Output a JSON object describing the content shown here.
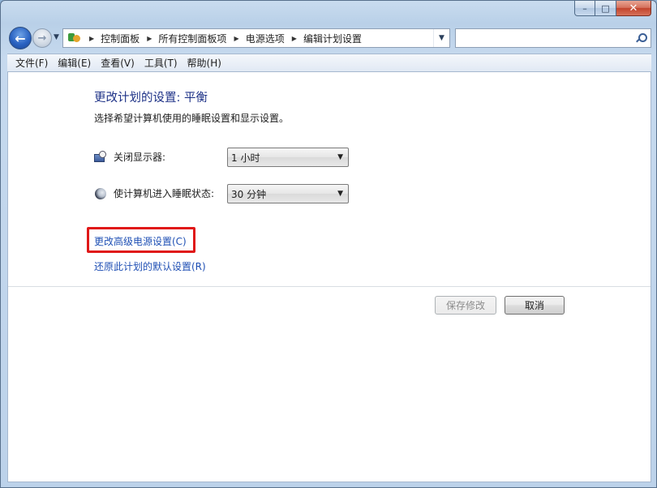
{
  "window": {
    "controls": {
      "minimize": "▭",
      "maximize": "□",
      "close": "✕"
    }
  },
  "address": {
    "breadcrumbs": [
      "控制面板",
      "所有控制面板项",
      "电源选项",
      "编辑计划设置"
    ],
    "icon": "control-panel-icon"
  },
  "search": {
    "placeholder": ""
  },
  "menu": {
    "items": [
      "文件(F)",
      "编辑(E)",
      "查看(V)",
      "工具(T)",
      "帮助(H)"
    ]
  },
  "main": {
    "title": "更改计划的设置: 平衡",
    "subtitle": "选择希望计算机使用的睡眠设置和显示设置。",
    "display_off": {
      "label": "关闭显示器:",
      "value": "1 小时",
      "icon": "monitor-clock-icon"
    },
    "sleep": {
      "label": "使计算机进入睡眠状态:",
      "value": "30 分钟",
      "icon": "moon-icon"
    },
    "links": {
      "advanced": "更改高级电源设置(C)",
      "restore": "还原此计划的默认设置(R)"
    },
    "buttons": {
      "save": "保存修改",
      "cancel": "取消"
    }
  },
  "colors": {
    "highlight": "#e01818",
    "link": "#1f4fb4",
    "title": "#1e3287"
  }
}
